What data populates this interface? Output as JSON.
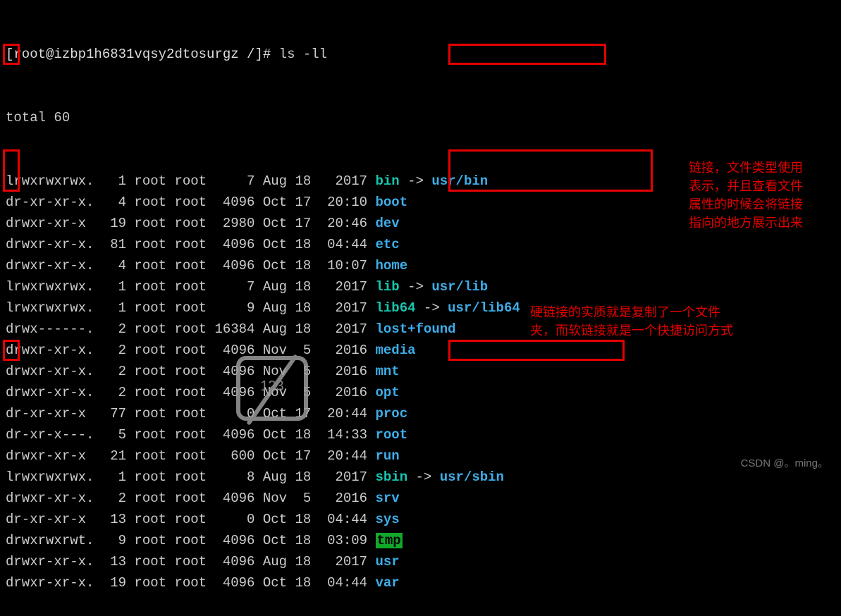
{
  "prompt": "[root@izbp1h6831vqsy2dtosurgz /]# ",
  "command": "ls -ll",
  "total_line": "total 60",
  "rows": [
    {
      "perm": "lrwxrwxrwx.",
      "links": "1",
      "owner": "root",
      "group": "root",
      "size": "7",
      "month": "Aug",
      "day": "18",
      "time": "2017",
      "name": "bin",
      "type": "link",
      "target": "usr/bin"
    },
    {
      "perm": "dr-xr-xr-x.",
      "links": "4",
      "owner": "root",
      "group": "root",
      "size": "4096",
      "month": "Oct",
      "day": "17",
      "time": "20:10",
      "name": "boot",
      "type": "dir"
    },
    {
      "perm": "drwxr-xr-x",
      "links": "19",
      "owner": "root",
      "group": "root",
      "size": "2980",
      "month": "Oct",
      "day": "17",
      "time": "20:46",
      "name": "dev",
      "type": "dir"
    },
    {
      "perm": "drwxr-xr-x.",
      "links": "81",
      "owner": "root",
      "group": "root",
      "size": "4096",
      "month": "Oct",
      "day": "18",
      "time": "04:44",
      "name": "etc",
      "type": "dir"
    },
    {
      "perm": "drwxr-xr-x.",
      "links": "4",
      "owner": "root",
      "group": "root",
      "size": "4096",
      "month": "Oct",
      "day": "18",
      "time": "10:07",
      "name": "home",
      "type": "dir"
    },
    {
      "perm": "lrwxrwxrwx.",
      "links": "1",
      "owner": "root",
      "group": "root",
      "size": "7",
      "month": "Aug",
      "day": "18",
      "time": "2017",
      "name": "lib",
      "type": "link",
      "target": "usr/lib"
    },
    {
      "perm": "lrwxrwxrwx.",
      "links": "1",
      "owner": "root",
      "group": "root",
      "size": "9",
      "month": "Aug",
      "day": "18",
      "time": "2017",
      "name": "lib64",
      "type": "link",
      "target": "usr/lib64"
    },
    {
      "perm": "drwx------.",
      "links": "2",
      "owner": "root",
      "group": "root",
      "size": "16384",
      "month": "Aug",
      "day": "18",
      "time": "2017",
      "name": "lost+found",
      "type": "dir"
    },
    {
      "perm": "drwxr-xr-x.",
      "links": "2",
      "owner": "root",
      "group": "root",
      "size": "4096",
      "month": "Nov",
      "day": "5",
      "time": "2016",
      "name": "media",
      "type": "dir"
    },
    {
      "perm": "drwxr-xr-x.",
      "links": "2",
      "owner": "root",
      "group": "root",
      "size": "4096",
      "month": "Nov",
      "day": "5",
      "time": "2016",
      "name": "mnt",
      "type": "dir"
    },
    {
      "perm": "drwxr-xr-x.",
      "links": "2",
      "owner": "root",
      "group": "root",
      "size": "4096",
      "month": "Nov",
      "day": "5",
      "time": "2016",
      "name": "opt",
      "type": "dir"
    },
    {
      "perm": "dr-xr-xr-x",
      "links": "77",
      "owner": "root",
      "group": "root",
      "size": "0",
      "month": "Oct",
      "day": "17",
      "time": "20:44",
      "name": "proc",
      "type": "dir"
    },
    {
      "perm": "dr-xr-x---.",
      "links": "5",
      "owner": "root",
      "group": "root",
      "size": "4096",
      "month": "Oct",
      "day": "18",
      "time": "14:33",
      "name": "root",
      "type": "dir"
    },
    {
      "perm": "drwxr-xr-x",
      "links": "21",
      "owner": "root",
      "group": "root",
      "size": "600",
      "month": "Oct",
      "day": "17",
      "time": "20:44",
      "name": "run",
      "type": "dir"
    },
    {
      "perm": "lrwxrwxrwx.",
      "links": "1",
      "owner": "root",
      "group": "root",
      "size": "8",
      "month": "Aug",
      "day": "18",
      "time": "2017",
      "name": "sbin",
      "type": "link",
      "target": "usr/sbin"
    },
    {
      "perm": "drwxr-xr-x.",
      "links": "2",
      "owner": "root",
      "group": "root",
      "size": "4096",
      "month": "Nov",
      "day": "5",
      "time": "2016",
      "name": "srv",
      "type": "dir"
    },
    {
      "perm": "dr-xr-xr-x",
      "links": "13",
      "owner": "root",
      "group": "root",
      "size": "0",
      "month": "Oct",
      "day": "18",
      "time": "04:44",
      "name": "sys",
      "type": "dir"
    },
    {
      "perm": "drwxrwxrwt.",
      "links": "9",
      "owner": "root",
      "group": "root",
      "size": "4096",
      "month": "Oct",
      "day": "18",
      "time": "03:09",
      "name": "tmp",
      "type": "tmp"
    },
    {
      "perm": "drwxr-xr-x.",
      "links": "13",
      "owner": "root",
      "group": "root",
      "size": "4096",
      "month": "Aug",
      "day": "18",
      "time": "2017",
      "name": "usr",
      "type": "dir"
    },
    {
      "perm": "drwxr-xr-x.",
      "links": "19",
      "owner": "root",
      "group": "root",
      "size": "4096",
      "month": "Oct",
      "day": "18",
      "time": "04:44",
      "name": "var",
      "type": "dir"
    }
  ],
  "annotations": {
    "right1_l1": "链接，文件类型使用",
    "right1_l2": "表示，并且查看文件",
    "right1_l3": "属性的时候会将链接",
    "right1_l4": "指向的地方展示出来",
    "right2_l1": "硬链接的实质就是复制了一个文件",
    "right2_l2": "夹，而软链接就是一个快捷访问方式"
  },
  "watermark": "123",
  "csdn": "CSDN @。ming。"
}
